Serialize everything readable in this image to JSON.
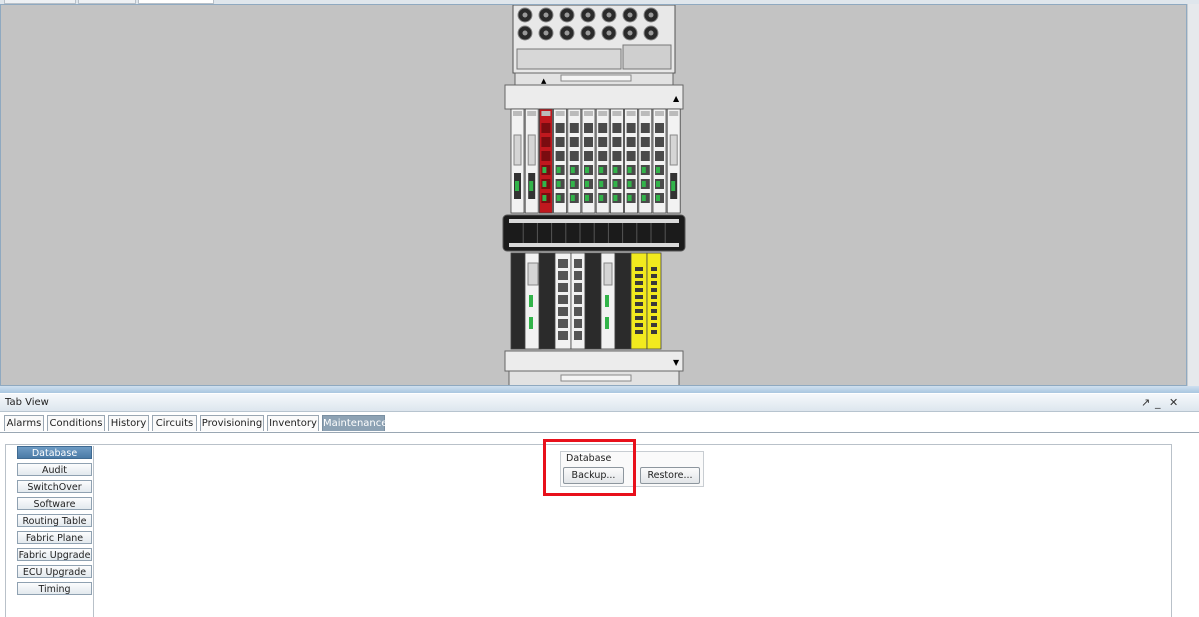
{
  "tab_view": {
    "title": "Tab View",
    "controls": {
      "float": "↗",
      "minimize": "_",
      "close": "✕"
    },
    "tabs": [
      {
        "label": "Alarms"
      },
      {
        "label": "Conditions"
      },
      {
        "label": "History"
      },
      {
        "label": "Circuits"
      },
      {
        "label": "Provisioning"
      },
      {
        "label": "Inventory"
      },
      {
        "label": "Maintenance",
        "active": true
      }
    ]
  },
  "maintenance": {
    "nav": [
      {
        "label": "Database",
        "active": true
      },
      {
        "label": "Audit"
      },
      {
        "label": "SwitchOver"
      },
      {
        "label": "Software"
      },
      {
        "label": "Routing Table"
      },
      {
        "label": "Fabric Plane"
      },
      {
        "label": "Fabric Upgrade"
      },
      {
        "label": "ECU Upgrade"
      },
      {
        "label": "Timing"
      }
    ],
    "database": {
      "group_label": "Database",
      "backup_label": "Backup...",
      "restore_label": "Restore..."
    }
  },
  "colors": {
    "shelf_background": "#c3c3c3",
    "active_tab": "#8da2b4",
    "active_nav": "#4a7aa6",
    "highlight": "#e8101b",
    "alarm_card": "#c0181e",
    "yellow_card": "#f2ea1e",
    "port_led": "#32b44a"
  }
}
